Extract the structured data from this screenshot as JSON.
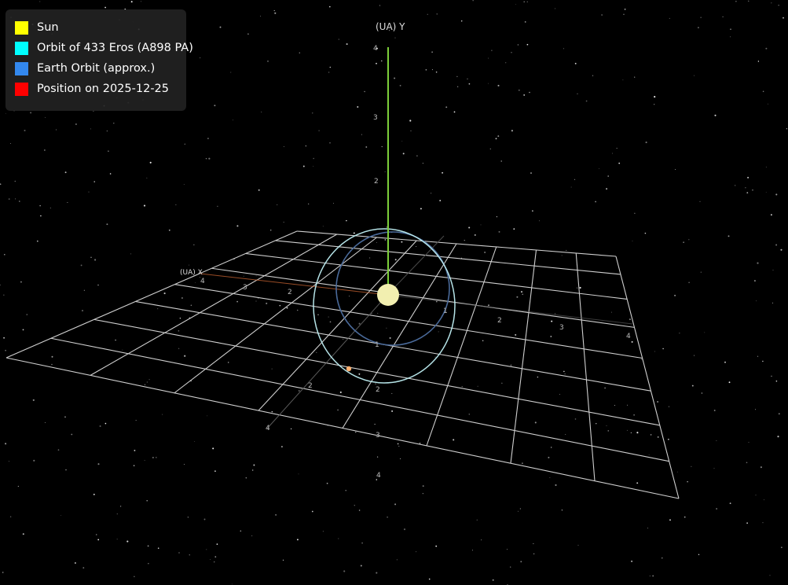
{
  "legend": {
    "items": [
      {
        "label": "Sun",
        "color": "#ffff00",
        "icon": "sun-swatch"
      },
      {
        "label": "Orbit of 433 Eros (A898 PA)",
        "color": "#00ffff",
        "icon": "orbit-swatch"
      },
      {
        "label": "Earth Orbit (approx.)",
        "color": "#3388ee",
        "icon": "earth-orbit-swatch"
      },
      {
        "label": "Position on 2025-12-25",
        "color": "#ff0000",
        "icon": "position-swatch"
      }
    ]
  },
  "axes": {
    "y_label": "(UA) Y",
    "x_label": "(UA) X",
    "y_ticks": [
      "4",
      "3",
      "2"
    ],
    "x_ticks": [
      "4",
      "3",
      "2"
    ],
    "scene_ticks": [
      "1",
      "2",
      "3",
      "4"
    ]
  },
  "colors": {
    "background": "#000000",
    "grid": "#cfcfcf",
    "y_axis": "#7ccf3a",
    "sun": "#f2efb0",
    "eros_orbit": "#bfeff3",
    "earth_orbit": "#4a6a9a",
    "position_marker": "#ffb070"
  }
}
